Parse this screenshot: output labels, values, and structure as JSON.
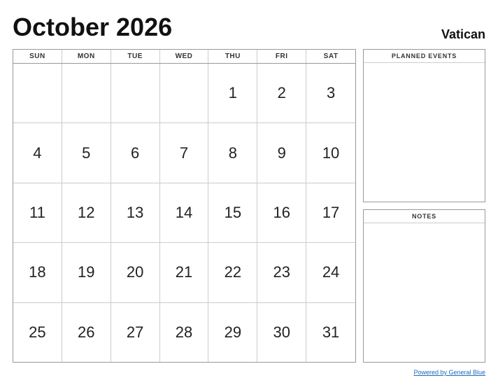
{
  "header": {
    "title": "October 2026",
    "country": "Vatican"
  },
  "calendar": {
    "day_headers": [
      "SUN",
      "MON",
      "TUE",
      "WED",
      "THU",
      "FRI",
      "SAT"
    ],
    "weeks": [
      [
        "",
        "",
        "",
        "",
        "1",
        "2",
        "3"
      ],
      [
        "4",
        "5",
        "6",
        "7",
        "8",
        "9",
        "10"
      ],
      [
        "11",
        "12",
        "13",
        "14",
        "15",
        "16",
        "17"
      ],
      [
        "18",
        "19",
        "20",
        "21",
        "22",
        "23",
        "24"
      ],
      [
        "25",
        "26",
        "27",
        "28",
        "29",
        "30",
        "31"
      ]
    ]
  },
  "sidebar": {
    "planned_events_label": "PLANNED EVENTS",
    "notes_label": "NOTES"
  },
  "footer": {
    "link_text": "Powered by General Blue"
  }
}
